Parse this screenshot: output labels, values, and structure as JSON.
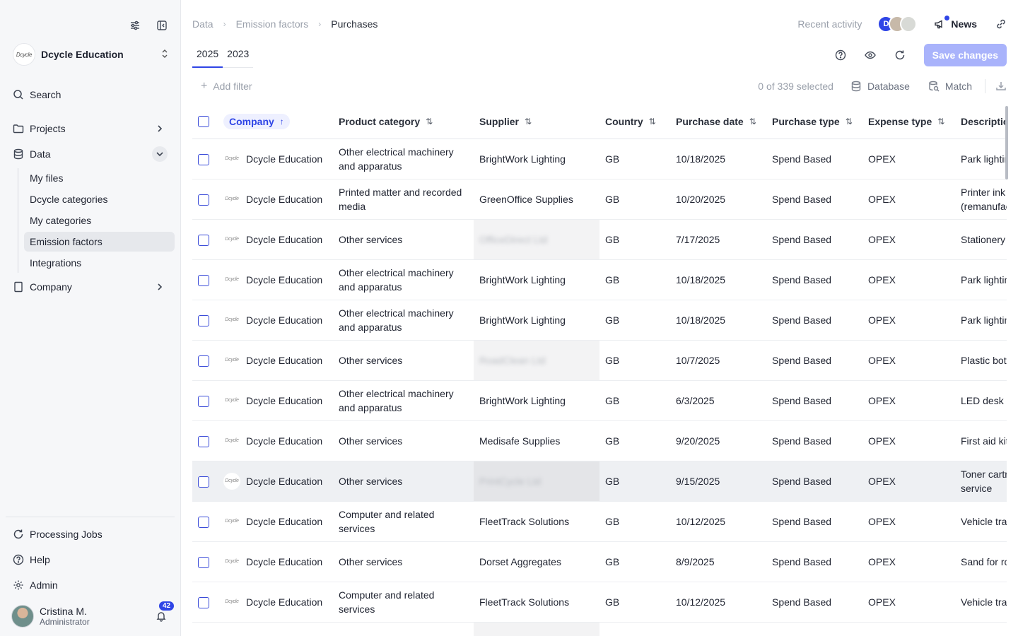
{
  "sidebar": {
    "org_name": "Dcycle Education",
    "org_logo": "Dcycle",
    "nav": {
      "search": "Search",
      "projects": "Projects",
      "data": "Data",
      "company": "Company"
    },
    "data_sub": [
      "My files",
      "Dcycle categories",
      "My categories",
      "Emission factors",
      "Integrations"
    ],
    "bottom": {
      "processing_jobs": "Processing Jobs",
      "help": "Help",
      "admin": "Admin"
    },
    "user": {
      "name": "Cristina M.",
      "role": "Administrator",
      "notifications": "42"
    }
  },
  "header": {
    "breadcrumb": [
      "Data",
      "Emission factors",
      "Purchases"
    ],
    "recent_activity": "Recent activity",
    "presence_initial": "D",
    "news": "News"
  },
  "tabs": [
    "2025",
    "2023"
  ],
  "save_label": "Save changes",
  "toolbar": {
    "add_filter": "Add filter",
    "selected": "0 of 339 selected",
    "database": "Database",
    "match": "Match"
  },
  "table": {
    "columns": [
      "Company",
      "Product category",
      "Supplier",
      "Country",
      "Purchase date",
      "Purchase type",
      "Expense type",
      "Description"
    ],
    "logo_text": "Dcycle",
    "rows": [
      {
        "company": "Dcycle Education",
        "category": "Other electrical machinery and apparatus",
        "supplier": "BrightWork Lighting",
        "country": "GB",
        "date": "10/18/2025",
        "ptype": "Spend Based",
        "etype": "OPEX",
        "desc": "Park lighting"
      },
      {
        "company": "Dcycle Education",
        "category": "Printed matter and recorded media",
        "supplier": "GreenOffice Supplies",
        "country": "GB",
        "date": "10/20/2025",
        "ptype": "Spend Based",
        "etype": "OPEX",
        "desc": "Printer ink (remanufactured)"
      },
      {
        "company": "Dcycle Education",
        "category": "Other services",
        "supplier": "OfficeDirect Ltd",
        "country": "GB",
        "date": "7/17/2025",
        "ptype": "Spend Based",
        "etype": "OPEX",
        "desc": "Stationery"
      },
      {
        "company": "Dcycle Education",
        "category": "Other electrical machinery and apparatus",
        "supplier": "BrightWork Lighting",
        "country": "GB",
        "date": "10/18/2025",
        "ptype": "Spend Based",
        "etype": "OPEX",
        "desc": "Park lighting"
      },
      {
        "company": "Dcycle Education",
        "category": "Other electrical machinery and apparatus",
        "supplier": "BrightWork Lighting",
        "country": "GB",
        "date": "10/18/2025",
        "ptype": "Spend Based",
        "etype": "OPEX",
        "desc": "Park lighting"
      },
      {
        "company": "Dcycle Education",
        "category": "Other services",
        "supplier": "RoadClean Ltd",
        "country": "GB",
        "date": "10/7/2025",
        "ptype": "Spend Based",
        "etype": "OPEX",
        "desc": "Plastic bottles"
      },
      {
        "company": "Dcycle Education",
        "category": "Other electrical machinery and apparatus",
        "supplier": "BrightWork Lighting",
        "country": "GB",
        "date": "6/3/2025",
        "ptype": "Spend Based",
        "etype": "OPEX",
        "desc": "LED desk lamps"
      },
      {
        "company": "Dcycle Education",
        "category": "Other services",
        "supplier": "Medisafe Supplies",
        "country": "GB",
        "date": "9/20/2025",
        "ptype": "Spend Based",
        "etype": "OPEX",
        "desc": "First aid kits"
      },
      {
        "company": "Dcycle Education",
        "category": "Other services",
        "supplier": "PrintCycle Ltd",
        "country": "GB",
        "date": "9/15/2025",
        "ptype": "Spend Based",
        "etype": "OPEX",
        "desc": "Toner cartridge service"
      },
      {
        "company": "Dcycle Education",
        "category": "Computer and related services",
        "supplier": "FleetTrack Solutions",
        "country": "GB",
        "date": "10/12/2025",
        "ptype": "Spend Based",
        "etype": "OPEX",
        "desc": "Vehicle tracking"
      },
      {
        "company": "Dcycle Education",
        "category": "Other services",
        "supplier": "Dorset Aggregates",
        "country": "GB",
        "date": "8/9/2025",
        "ptype": "Spend Based",
        "etype": "OPEX",
        "desc": "Sand for roads"
      },
      {
        "company": "Dcycle Education",
        "category": "Computer and related services",
        "supplier": "FleetTrack Solutions",
        "country": "GB",
        "date": "10/12/2025",
        "ptype": "Spend Based",
        "etype": "OPEX",
        "desc": "Vehicle tracking"
      },
      {
        "company": "",
        "category": "",
        "supplier": "",
        "country": "",
        "date": "",
        "ptype": "",
        "etype": "",
        "desc": ""
      }
    ]
  },
  "colors": {
    "accent": "#2f45e6",
    "save_disabled": "#a9b3fb",
    "sidebar_bg": "#f6f7f9"
  }
}
